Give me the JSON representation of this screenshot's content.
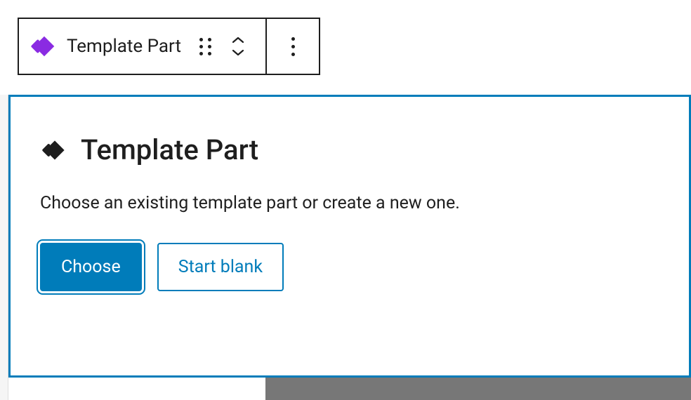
{
  "toolbar": {
    "block_label": "Template Part",
    "icon": "template-part-icon",
    "drag": "drag-handle",
    "move_up": "move-up",
    "move_down": "move-down",
    "more": "more-options"
  },
  "placeholder": {
    "title": "Template Part",
    "description": "Choose an existing template part or create a new one.",
    "choose_label": "Choose",
    "start_blank_label": "Start blank"
  },
  "colors": {
    "primary": "#007cba",
    "icon_accent": "#8a2be2"
  }
}
